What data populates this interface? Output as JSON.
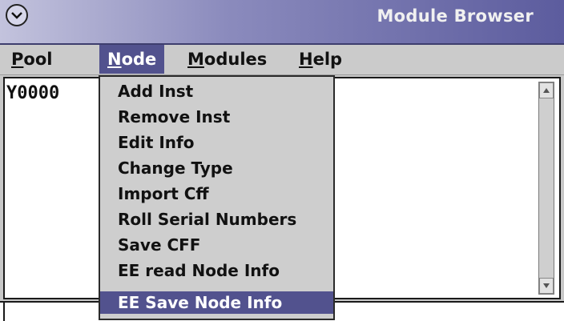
{
  "window": {
    "title": "Module Browser",
    "control_icon": "chevron-down-circle-icon"
  },
  "menubar": {
    "items": [
      {
        "label": "Pool",
        "accel": "P",
        "rest": "ool"
      },
      {
        "label": "Node",
        "accel": "N",
        "rest": "ode"
      },
      {
        "label": "Modules",
        "accel": "M",
        "rest": "odules"
      },
      {
        "label": "Help",
        "accel": "H",
        "rest": "elp"
      }
    ],
    "active": "Node"
  },
  "list": {
    "first_row": "Y0000"
  },
  "node_menu": {
    "items": [
      "Add Inst",
      "Remove Inst",
      "Edit Info",
      "Change Type",
      "Import Cff",
      "Roll Serial Numbers",
      "Save CFF",
      "EE read Node Info",
      "EE Save Node Info"
    ],
    "selected": "EE Save Node Info"
  },
  "colors": {
    "highlight": "#52528e",
    "title_gradient_start": "#c3c3dd",
    "title_gradient_end": "#5c5c9e",
    "menu_bg": "#cbcbcb"
  }
}
